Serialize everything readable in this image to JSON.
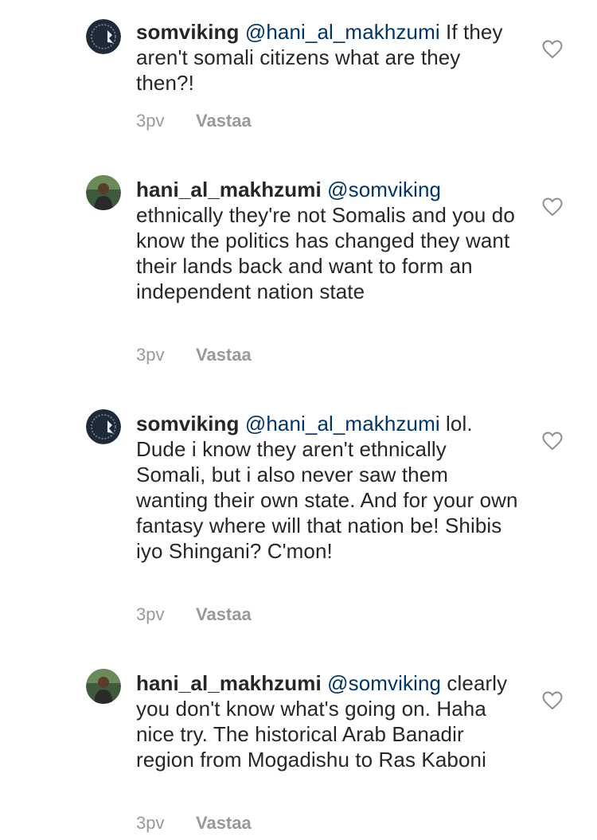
{
  "comments": [
    {
      "avatar": "dark-circular-logo-avatar",
      "username": "somviking",
      "mention": "@hani_al_makhzumi",
      "text": " If they aren't somali citizens what are they then?!",
      "time": "3pv",
      "reply": "Vastaa",
      "like_icon": "heart-outline-icon"
    },
    {
      "avatar": "person-photo-avatar",
      "username": "hani_al_makhzumi",
      "mention": "@somviking",
      "text": " ethnically they're not Somalis and you do know the politics has changed they want their lands back and want to form an independent nation state",
      "time": "3pv",
      "reply": "Vastaa",
      "like_icon": "heart-outline-icon"
    },
    {
      "avatar": "dark-circular-logo-avatar",
      "username": "somviking",
      "mention": "@hani_al_makhzumi",
      "text": " lol. Dude i know they aren't ethnically Somali, but i also never saw them wanting their own state. And for your own fantasy where will that nation be! Shibis iyo Shingani? C'mon!",
      "time": "3pv",
      "reply": "Vastaa",
      "like_icon": "heart-outline-icon"
    },
    {
      "avatar": "person-photo-avatar",
      "username": "hani_al_makhzumi",
      "mention": "@somviking",
      "text": " clearly you don't know what's going on. Haha nice try. The historical Arab Banadir region from Mogadishu to Ras Kaboni",
      "time": "3pv",
      "reply": "Vastaa",
      "like_icon": "heart-outline-icon"
    }
  ]
}
